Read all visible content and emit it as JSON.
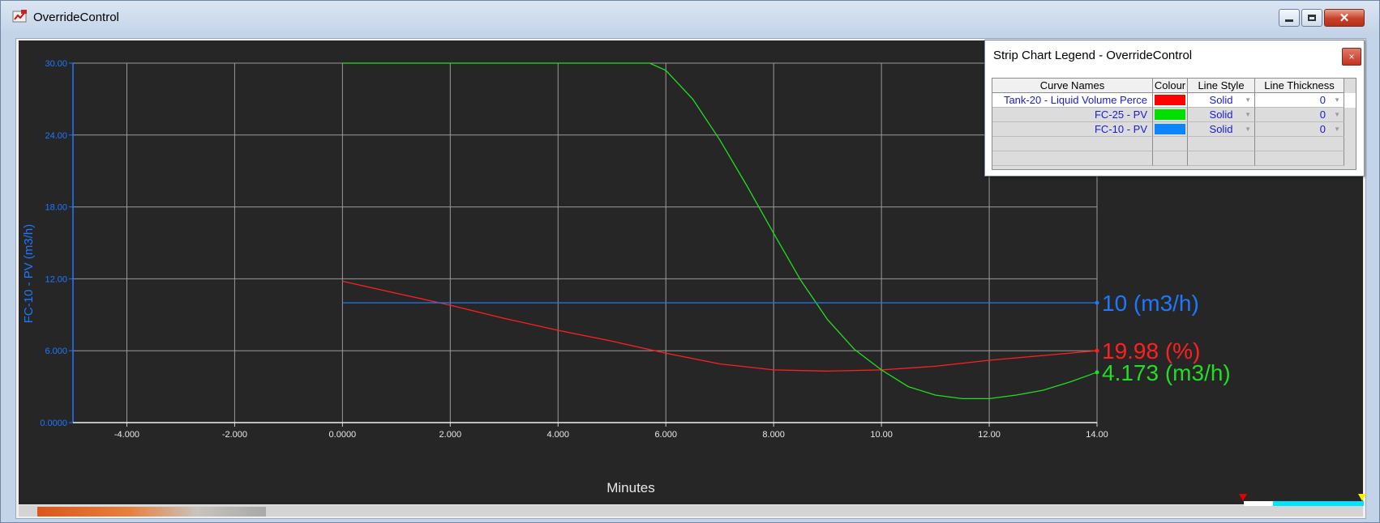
{
  "window": {
    "title": "OverrideControl",
    "icon": "app-icon",
    "minimize_icon": "minimize-icon",
    "maximize_icon": "maximize-icon",
    "close_icon": "close-icon"
  },
  "chart": {
    "background": "#262626",
    "axis_color": "#1e78ff",
    "grid_color": "#9a9a9a"
  },
  "chart_data": {
    "type": "line",
    "xlabel": "Minutes",
    "ylabel": "FC-10 - PV (m3/h)",
    "xlim": [
      -5.0,
      14.0
    ],
    "ylim": [
      0,
      30
    ],
    "x_ticks": [
      "-4.000",
      "-2.000",
      "0.0000",
      "2.000",
      "4.000",
      "6.000",
      "8.000",
      "10.00",
      "12.00",
      "14.00"
    ],
    "x_tick_values": [
      -4,
      -2,
      0,
      2,
      4,
      6,
      8,
      10,
      12,
      14
    ],
    "y_ticks": [
      "0.0000",
      "6.000",
      "12.00",
      "18.00",
      "24.00",
      "30.00"
    ],
    "y_tick_values": [
      0,
      6,
      12,
      18,
      24,
      30
    ],
    "grid": true,
    "series": [
      {
        "name": "Tank-20 - Liquid Volume Perce",
        "color": "#ff2020",
        "x": [
          0,
          1,
          2,
          3,
          4,
          5,
          6,
          7,
          8,
          9,
          10,
          11,
          12,
          13,
          14
        ],
        "y": [
          11.8,
          10.8,
          9.8,
          8.7,
          7.7,
          6.8,
          5.8,
          4.9,
          4.4,
          4.3,
          4.4,
          4.7,
          5.2,
          5.6,
          6.0
        ],
        "end_label": "19.98 (%)"
      },
      {
        "name": "FC-25 - PV",
        "color": "#22dd22",
        "x": [
          0,
          5.7,
          6,
          6.5,
          7,
          7.5,
          8,
          8.5,
          9,
          9.5,
          10,
          10.5,
          11,
          11.5,
          12,
          12.5,
          13,
          13.5,
          14
        ],
        "y": [
          30.0,
          30.0,
          29.4,
          27.0,
          23.6,
          19.8,
          15.8,
          11.9,
          8.6,
          6.1,
          4.4,
          3.0,
          2.3,
          2.0,
          2.0,
          2.3,
          2.7,
          3.4,
          4.2
        ],
        "end_label": "4.173 (m3/h)"
      },
      {
        "name": "FC-10 - PV",
        "color": "#1e78ff",
        "x": [
          0,
          14
        ],
        "y": [
          10.0,
          10.0
        ],
        "end_label": "10 (m3/h)"
      }
    ]
  },
  "legend": {
    "title": "Strip Chart Legend - OverrideControl",
    "close_label": "×",
    "columns": [
      "Curve Names",
      "Colour",
      "Line Style",
      "Line Thickness"
    ],
    "rows": [
      {
        "name": "Tank-20 - Liquid Volume Perce",
        "colour": "#ff0000",
        "style": "Solid",
        "thickness": "0"
      },
      {
        "name": "FC-25 - PV",
        "colour": "#00e000",
        "style": "Solid",
        "thickness": "0"
      },
      {
        "name": "FC-10 - PV",
        "colour": "#0a84ff",
        "style": "Solid",
        "thickness": "0"
      }
    ]
  }
}
